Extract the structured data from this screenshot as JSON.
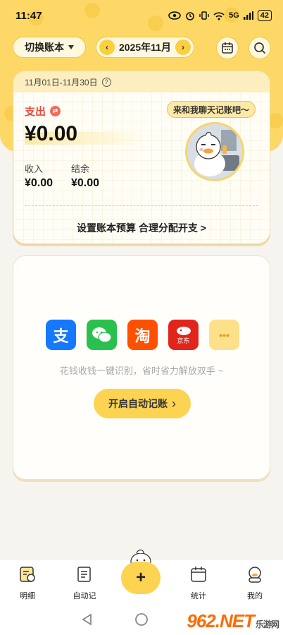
{
  "status_bar": {
    "time": "11:47",
    "network": "5G",
    "battery": "42"
  },
  "header": {
    "switch_book_label": "切换账本",
    "month_label": "2025年11月",
    "prev_symbol": "‹",
    "next_symbol": "›"
  },
  "summary": {
    "date_range": "11月01日-11月30日",
    "help_symbol": "?",
    "expense_label": "支出",
    "expense_amount": "¥0.00",
    "income_label": "收入",
    "income_amount": "¥0.00",
    "balance_label": "结余",
    "balance_amount": "¥0.00",
    "chat_prompt": "来和我聊天记账吧～",
    "budget_link": "设置账本预算 合理分配开支 >"
  },
  "auto_book": {
    "apps": [
      {
        "name": "alipay-icon",
        "glyph": "支",
        "color": "#1677ff"
      },
      {
        "name": "wechat-icon",
        "glyph": "",
        "color": "#2ac04d"
      },
      {
        "name": "taobao-icon",
        "glyph": "淘",
        "color": "#ff5000"
      },
      {
        "name": "jd-icon",
        "glyph": "京东",
        "color": "#e1251b"
      },
      {
        "name": "more-icon",
        "glyph": "•••",
        "color": "#fde08a"
      }
    ],
    "tip": "花钱收钱一键识别，省时省力解放双手 ~",
    "start_button": "开启自动记账",
    "start_chevron": "›"
  },
  "bottom_nav": {
    "items": [
      "明细",
      "自动记",
      "统计",
      "我的"
    ],
    "add_symbol": "+"
  },
  "watermark": {
    "main": "962.NET",
    "sub": "乐游网"
  },
  "colors": {
    "brand_yellow": "#fdd866",
    "expense_red": "#e54b3c",
    "button_yellow": "#fcd451"
  }
}
